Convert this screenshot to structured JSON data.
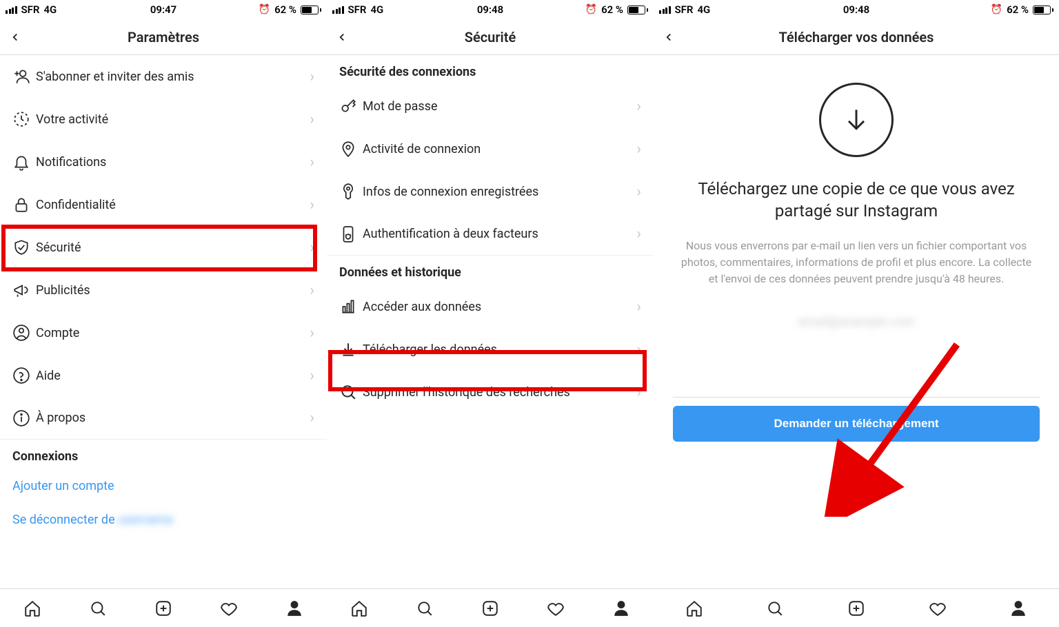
{
  "status": {
    "carrier": "SFR",
    "network": "4G",
    "battery_pct": "62 %",
    "time1": "09:47",
    "time2": "09:48",
    "time3": "09:48"
  },
  "screen1": {
    "title": "Paramètres",
    "items": [
      {
        "label": "S'abonner et inviter des amis"
      },
      {
        "label": "Votre activité"
      },
      {
        "label": "Notifications"
      },
      {
        "label": "Confidentialité"
      },
      {
        "label": "Sécurité"
      },
      {
        "label": "Publicités"
      },
      {
        "label": "Compte"
      },
      {
        "label": "Aide"
      },
      {
        "label": "À propos"
      }
    ],
    "section_connexions": "Connexions",
    "add_account": "Ajouter un compte",
    "logout_prefix": "Se déconnecter de ",
    "logout_user": "username"
  },
  "screen2": {
    "title": "Sécurité",
    "section1": "Sécurité des connexions",
    "items1": [
      {
        "label": "Mot de passe"
      },
      {
        "label": "Activité de connexion"
      },
      {
        "label": "Infos de connexion enregistrées"
      },
      {
        "label": "Authentification à deux facteurs"
      }
    ],
    "section2": "Données et historique",
    "items2": [
      {
        "label": "Accéder aux données"
      },
      {
        "label": "Télécharger les données"
      },
      {
        "label": "Supprimer l'historique des recherches"
      }
    ]
  },
  "screen3": {
    "title": "Télécharger vos données",
    "heading": "Téléchargez une copie de ce que vous avez partagé sur Instagram",
    "description": "Nous vous enverrons par e-mail un lien vers un fichier comportant vos photos, commentaires, informations de profil et plus encore. La collecte et l'envoi de ces données peuvent prendre jusqu'à 48 heures.",
    "email_placeholder": "email@example.com",
    "button": "Demander un téléchargement"
  },
  "annotations": {
    "highlight_color": "#e60000",
    "arrow_color": "#e60000"
  }
}
